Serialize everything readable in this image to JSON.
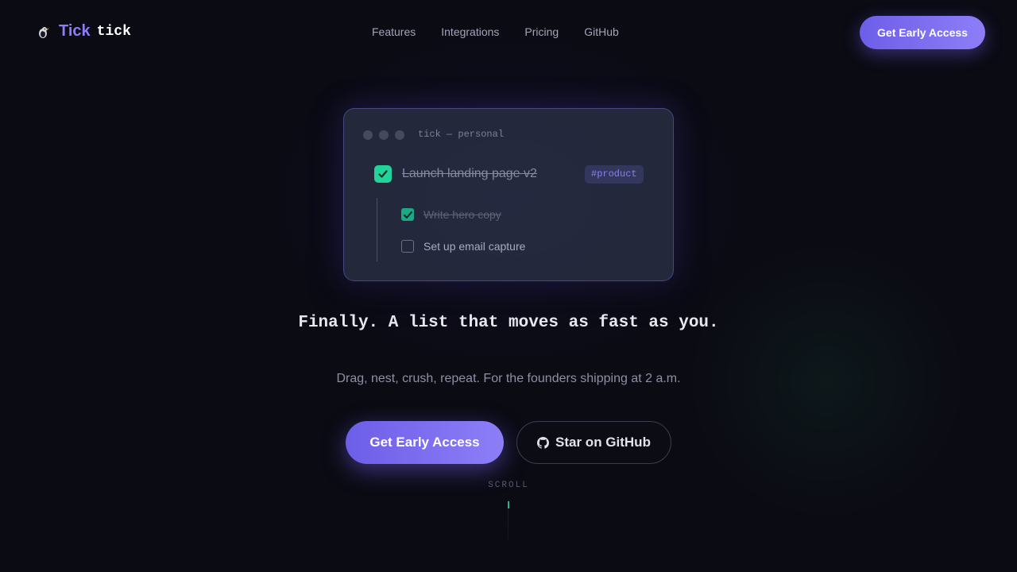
{
  "nav": {
    "logo_word_1": "Tick",
    "logo_word_2": "tick",
    "links": [
      "Features",
      "Integrations",
      "Pricing",
      "GitHub"
    ],
    "cta_label": "Get Early Access"
  },
  "card": {
    "title": "tick — personal",
    "main_task": {
      "label": "Launch landing page v2",
      "done": true,
      "tag": "#product"
    },
    "subtasks": [
      {
        "label": "Write hero copy",
        "done": true
      },
      {
        "label": "Set up email capture",
        "done": false
      }
    ]
  },
  "hero": {
    "headline": "Finally. A list that moves as fast as you.",
    "subheadline": "Drag, nest, crush, repeat. For the founders shipping at 2 a.m.",
    "primary_button": "Get Early Access",
    "secondary_button": "Star on GitHub",
    "scroll_label": "SCROLL"
  },
  "colors": {
    "background": "#0b0b14",
    "accent": "#7b6cf0",
    "success": "#22d39a"
  },
  "icons": {
    "logo": "bird-icon",
    "checkmark": "checkmark-icon",
    "github": "github-icon"
  }
}
